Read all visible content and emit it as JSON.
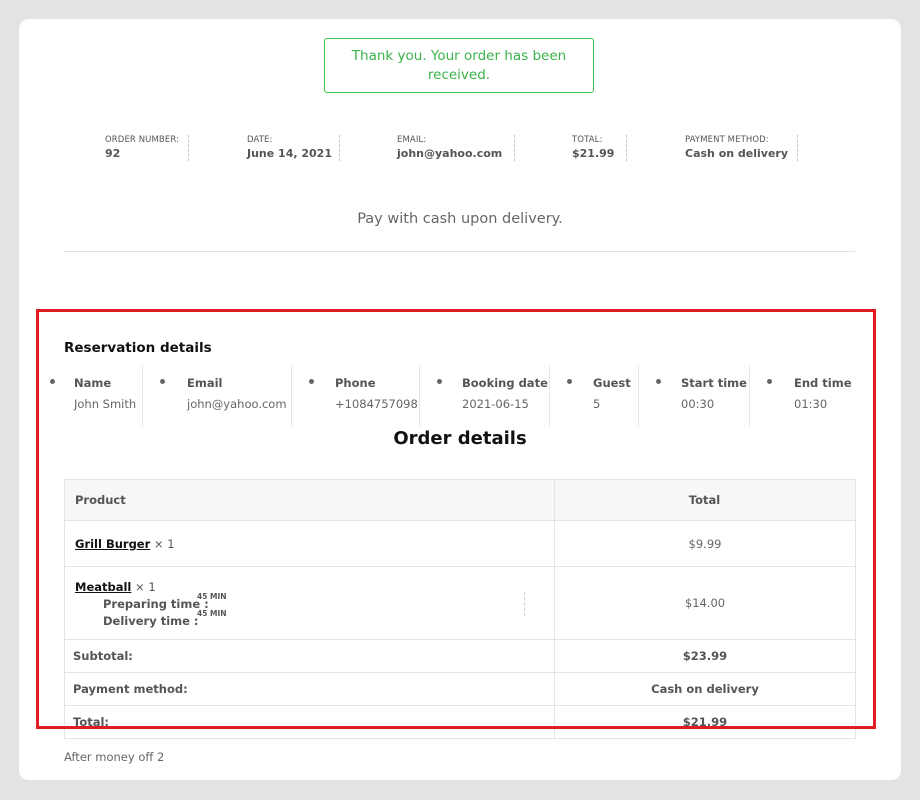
{
  "notice": {
    "text": "Thank you. Your order has been received."
  },
  "overview": [
    {
      "label": "ORDER NUMBER:",
      "value": "92"
    },
    {
      "label": "DATE:",
      "value": "June 14, 2021"
    },
    {
      "label": "EMAIL:",
      "value": "john@yahoo.com"
    },
    {
      "label": "TOTAL:",
      "value": "$21.99"
    },
    {
      "label": "PAYMENT METHOD:",
      "value": "Cash on delivery"
    }
  ],
  "pay_note": "Pay with cash upon delivery.",
  "reservation": {
    "title": "Reservation details",
    "columns": [
      {
        "head": "Name",
        "value": "John Smith"
      },
      {
        "head": "Email",
        "value": "john@yahoo.com"
      },
      {
        "head": "Phone",
        "value": "+1084757098"
      },
      {
        "head": "Booking date",
        "value": "2021-06-15"
      },
      {
        "head": "Guest",
        "value": "5"
      },
      {
        "head": "Start time",
        "value": "00:30"
      },
      {
        "head": "End time",
        "value": "01:30"
      }
    ]
  },
  "order_details": {
    "title": "Order details",
    "headers": {
      "product": "Product",
      "total": "Total"
    },
    "items": [
      {
        "name": "Grill Burger",
        "qty": "× 1",
        "total": "$9.99"
      },
      {
        "name": "Meatball",
        "qty": "× 1",
        "total": "$14.00",
        "preparing_label": "Preparing time :",
        "preparing_value": "45 MIN",
        "delivery_label": "Delivery time :",
        "delivery_value": "45 MIN"
      }
    ],
    "footer": [
      {
        "label": "Subtotal:",
        "value": "$23.99"
      },
      {
        "label": "Payment method:",
        "value": "Cash on delivery"
      },
      {
        "label": "Total:",
        "value": "$21.99"
      }
    ]
  },
  "after_note": "After money off 2"
}
